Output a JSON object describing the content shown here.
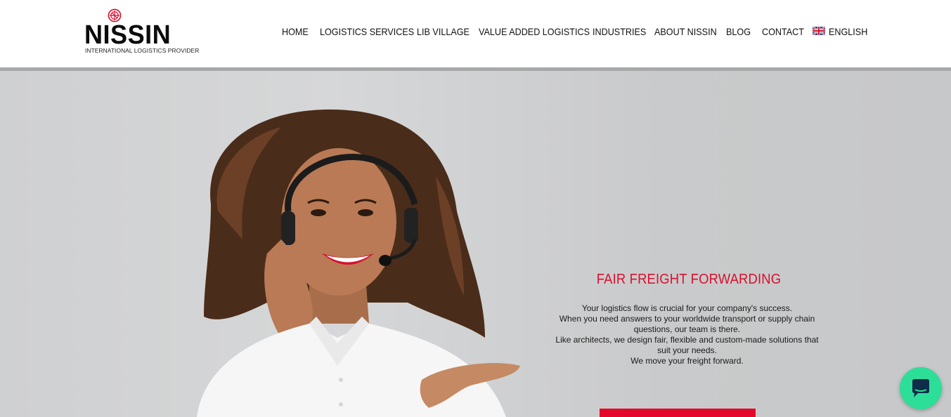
{
  "brand": {
    "name": "NISSIN",
    "tagline": "INTERNATIONAL LOGISTICS PROVIDER",
    "accent_color": "#d8102e"
  },
  "nav": {
    "items": [
      {
        "label": "HOME"
      },
      {
        "label": "LOGISTICS SERVICES"
      },
      {
        "label": "LIB VILLAGE"
      },
      {
        "label": "VALUE ADDED LOGISTICS"
      },
      {
        "label": "INDUSTRIES"
      },
      {
        "label": "ABOUT NISSIN"
      },
      {
        "label": "BLOG"
      },
      {
        "label": "CONTACT"
      }
    ],
    "language": {
      "label": "ENGLISH",
      "icon": "uk-flag-icon"
    }
  },
  "hero": {
    "image": "woman-with-headset-photo",
    "title": "FAIR FREIGHT FORWARDING",
    "lines": [
      "Your logistics flow is crucial for your company's success.",
      "When you need answers to your worldwide transport or supply chain questions, our team is there.",
      "Like architects, we design fair, flexible and custom-made solutions that suit your needs.",
      "We move your freight forward."
    ],
    "cta_color": "#e4082c"
  },
  "chat_widget": {
    "icon": "chat-bubble-icon",
    "color": "#2dde98"
  }
}
